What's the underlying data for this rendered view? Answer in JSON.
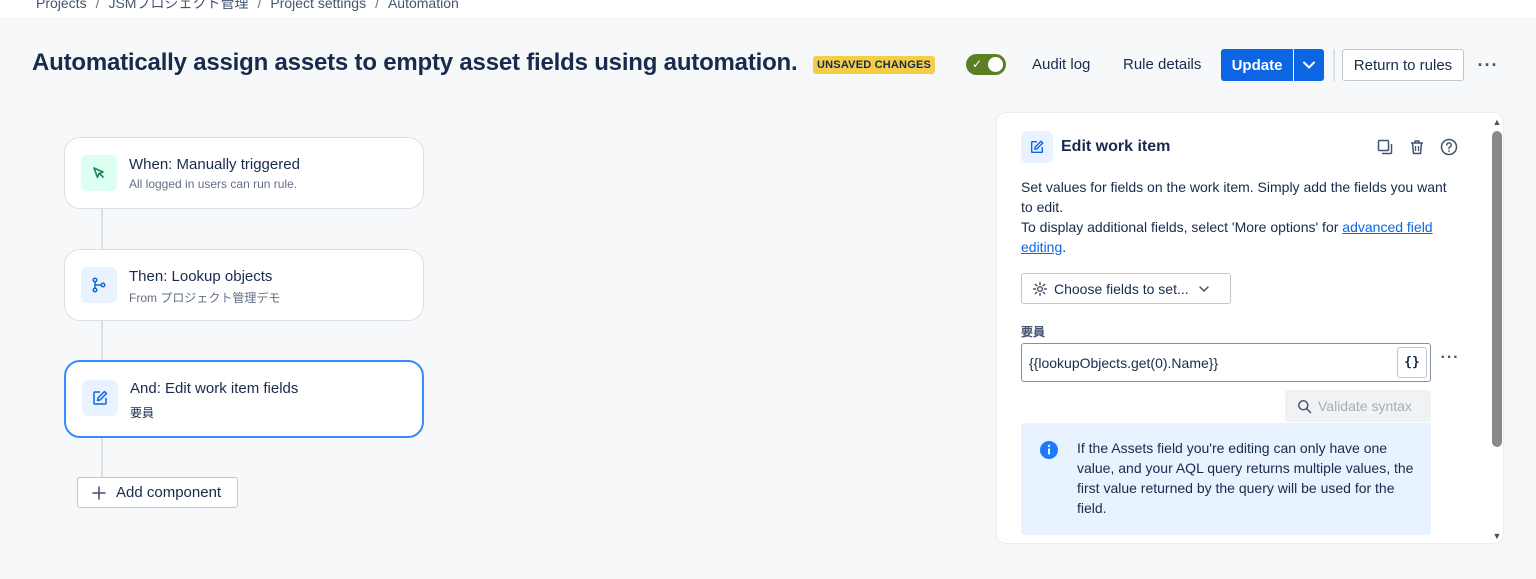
{
  "breadcrumb": [
    "Projects",
    "JSMプロジェクト管理",
    "Project settings",
    "Automation"
  ],
  "header": {
    "title": "Automatically assign assets to empty asset fields using automation.",
    "unsaved_badge": "UNSAVED CHANGES",
    "toggle_enabled": true,
    "audit_log": "Audit log",
    "rule_details": "Rule details",
    "update": "Update",
    "return_to_rules": "Return to rules"
  },
  "flow": {
    "nodes": [
      {
        "title": "When: Manually triggered",
        "subtitle": "All logged in users can run rule.",
        "icon": "cursor-click-icon"
      },
      {
        "title": "Then: Lookup objects",
        "subtitle": "From プロジェクト管理デモ",
        "icon": "branch-icon"
      },
      {
        "title": "And: Edit work item fields",
        "subtitle": "要員",
        "icon": "edit-icon"
      }
    ],
    "add_component": "Add component"
  },
  "panel": {
    "title": "Edit work item",
    "desc_line1": "Set values for fields on the work item. Simply add the fields you want to edit.",
    "desc_line2_prefix": "To display additional fields, select 'More options' for ",
    "desc_link": "advanced field editing",
    "desc_line2_suffix": ".",
    "choose_fields": "Choose fields to set...",
    "field_label": "要員",
    "field_value": "{{lookupObjects.get(0).Name}}",
    "brace_label": "{}",
    "validate": "Validate syntax",
    "info_text": "If the Assets field you're editing can only have one value, and your AQL query returns multiple values, the first value returned by the query will be used for the field."
  },
  "colors": {
    "primary": "#0c66e4",
    "toggle_on": "#5b7f24",
    "badge": "#f5cd47",
    "selected_border": "#388bff"
  }
}
